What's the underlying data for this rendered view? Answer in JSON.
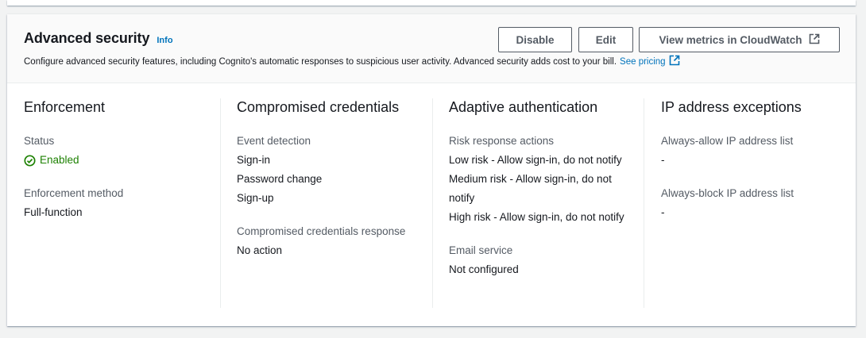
{
  "header": {
    "title": "Advanced security",
    "info_label": "Info",
    "description": "Configure advanced security features, including Cognito's automatic responses to suspicious user activity. Advanced security adds cost to your bill.",
    "pricing_link": "See pricing",
    "buttons": {
      "disable": "Disable",
      "edit": "Edit",
      "view_metrics": "View metrics in CloudWatch"
    }
  },
  "enforcement": {
    "title": "Enforcement",
    "status_label": "Status",
    "status_value": "Enabled",
    "method_label": "Enforcement method",
    "method_value": "Full-function"
  },
  "compromised": {
    "title": "Compromised credentials",
    "event_label": "Event detection",
    "events": [
      "Sign-in",
      "Password change",
      "Sign-up"
    ],
    "response_label": "Compromised credentials response",
    "response_value": "No action"
  },
  "adaptive": {
    "title": "Adaptive authentication",
    "risk_label": "Risk response actions",
    "risks": [
      "Low risk - Allow sign-in, do not notify",
      "Medium risk - Allow sign-in, do not notify",
      "High risk - Allow sign-in, do not notify"
    ],
    "email_label": "Email service",
    "email_value": "Not configured"
  },
  "ip": {
    "title": "IP address exceptions",
    "allow_label": "Always-allow IP address list",
    "allow_value": "-",
    "block_label": "Always-block IP address list",
    "block_value": "-"
  },
  "colors": {
    "link": "#0073bb",
    "success": "#1d8102",
    "label": "#545b64",
    "text": "#16191f"
  }
}
